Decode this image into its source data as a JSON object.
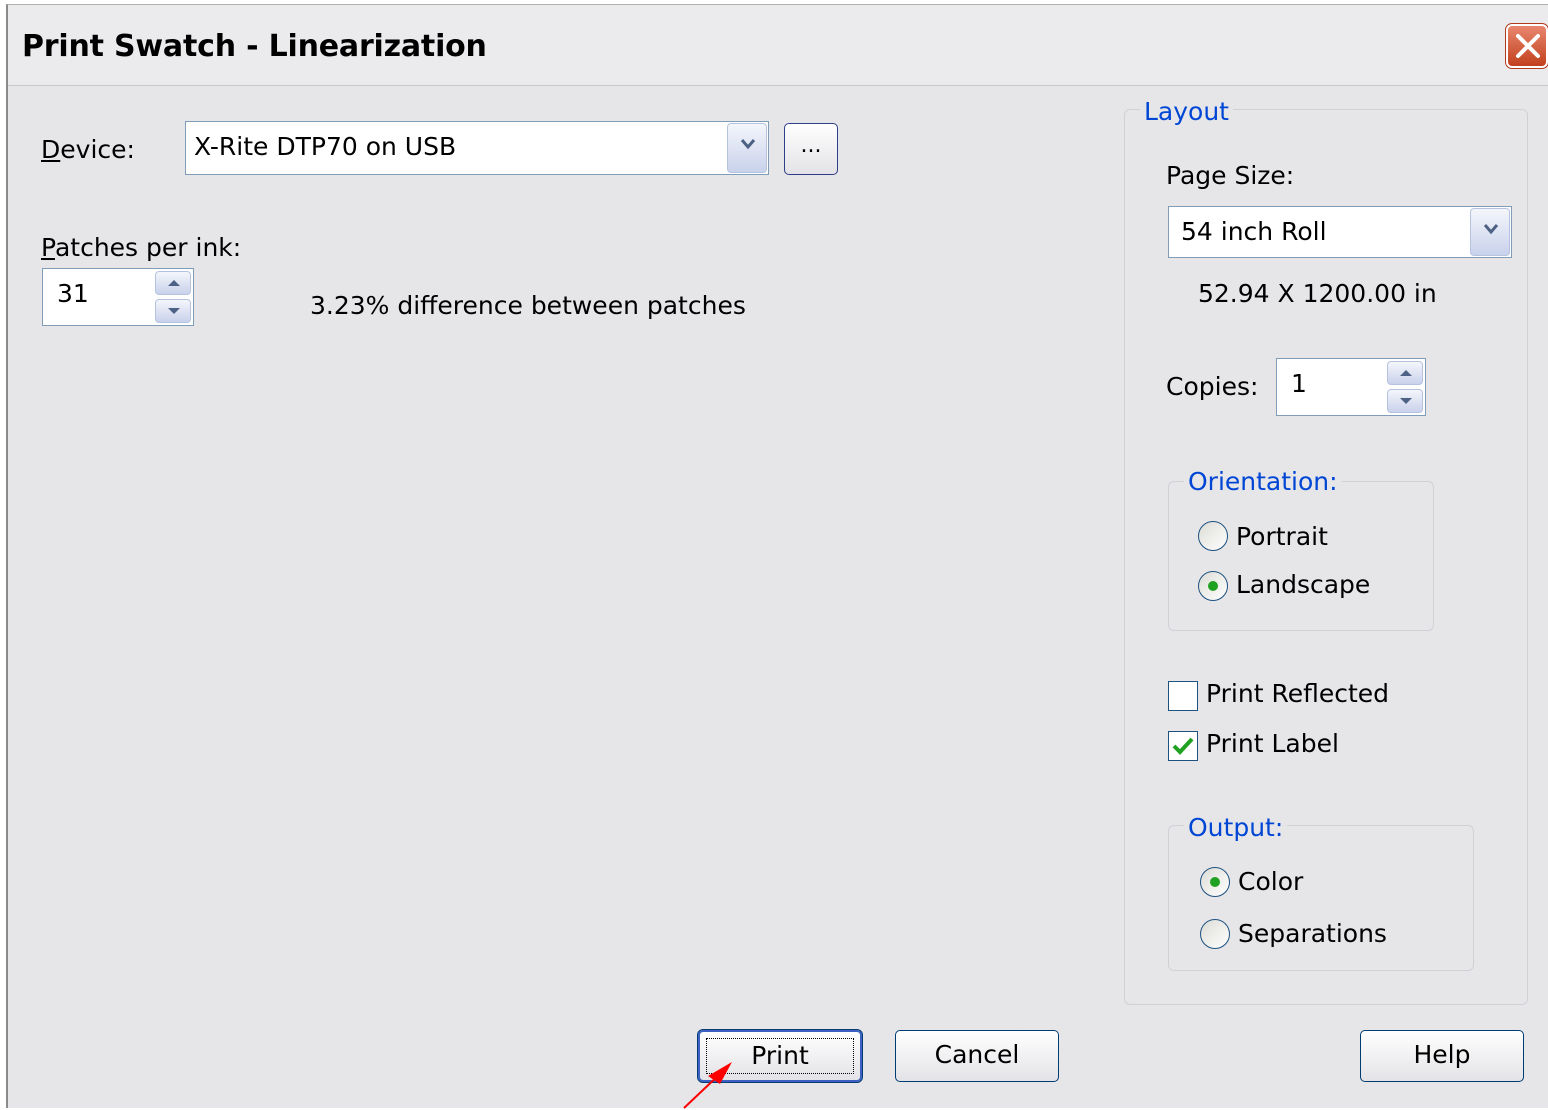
{
  "window": {
    "title": "Print Swatch - Linearization"
  },
  "device": {
    "label": "Device:",
    "value": "X-Rite DTP70 on USB",
    "browse_label": "..."
  },
  "patches": {
    "label": "Patches per ink:",
    "value": "31",
    "info": "3.23% difference between patches"
  },
  "layout": {
    "legend": "Layout",
    "page_size_label": "Page Size:",
    "page_size_value": "54 inch Roll",
    "dimensions": "52.94 X 1200.00  in",
    "copies_label": "Copies:",
    "copies_value": "1",
    "orientation": {
      "legend": "Orientation:",
      "portrait": "Portrait",
      "landscape": "Landscape",
      "selected": "Landscape"
    },
    "print_reflected": {
      "label": "Print Reflected",
      "checked": false
    },
    "print_label": {
      "label": "Print Label",
      "checked": true
    },
    "output": {
      "legend": "Output:",
      "color": "Color",
      "separations": "Separations",
      "selected": "Color"
    }
  },
  "buttons": {
    "print": "Print",
    "cancel": "Cancel",
    "help": "Help"
  },
  "colors": {
    "accent": "#0046d5",
    "radio_dot": "#21a121",
    "check": "#21a121",
    "annotation_arrow": "#ff0000"
  }
}
